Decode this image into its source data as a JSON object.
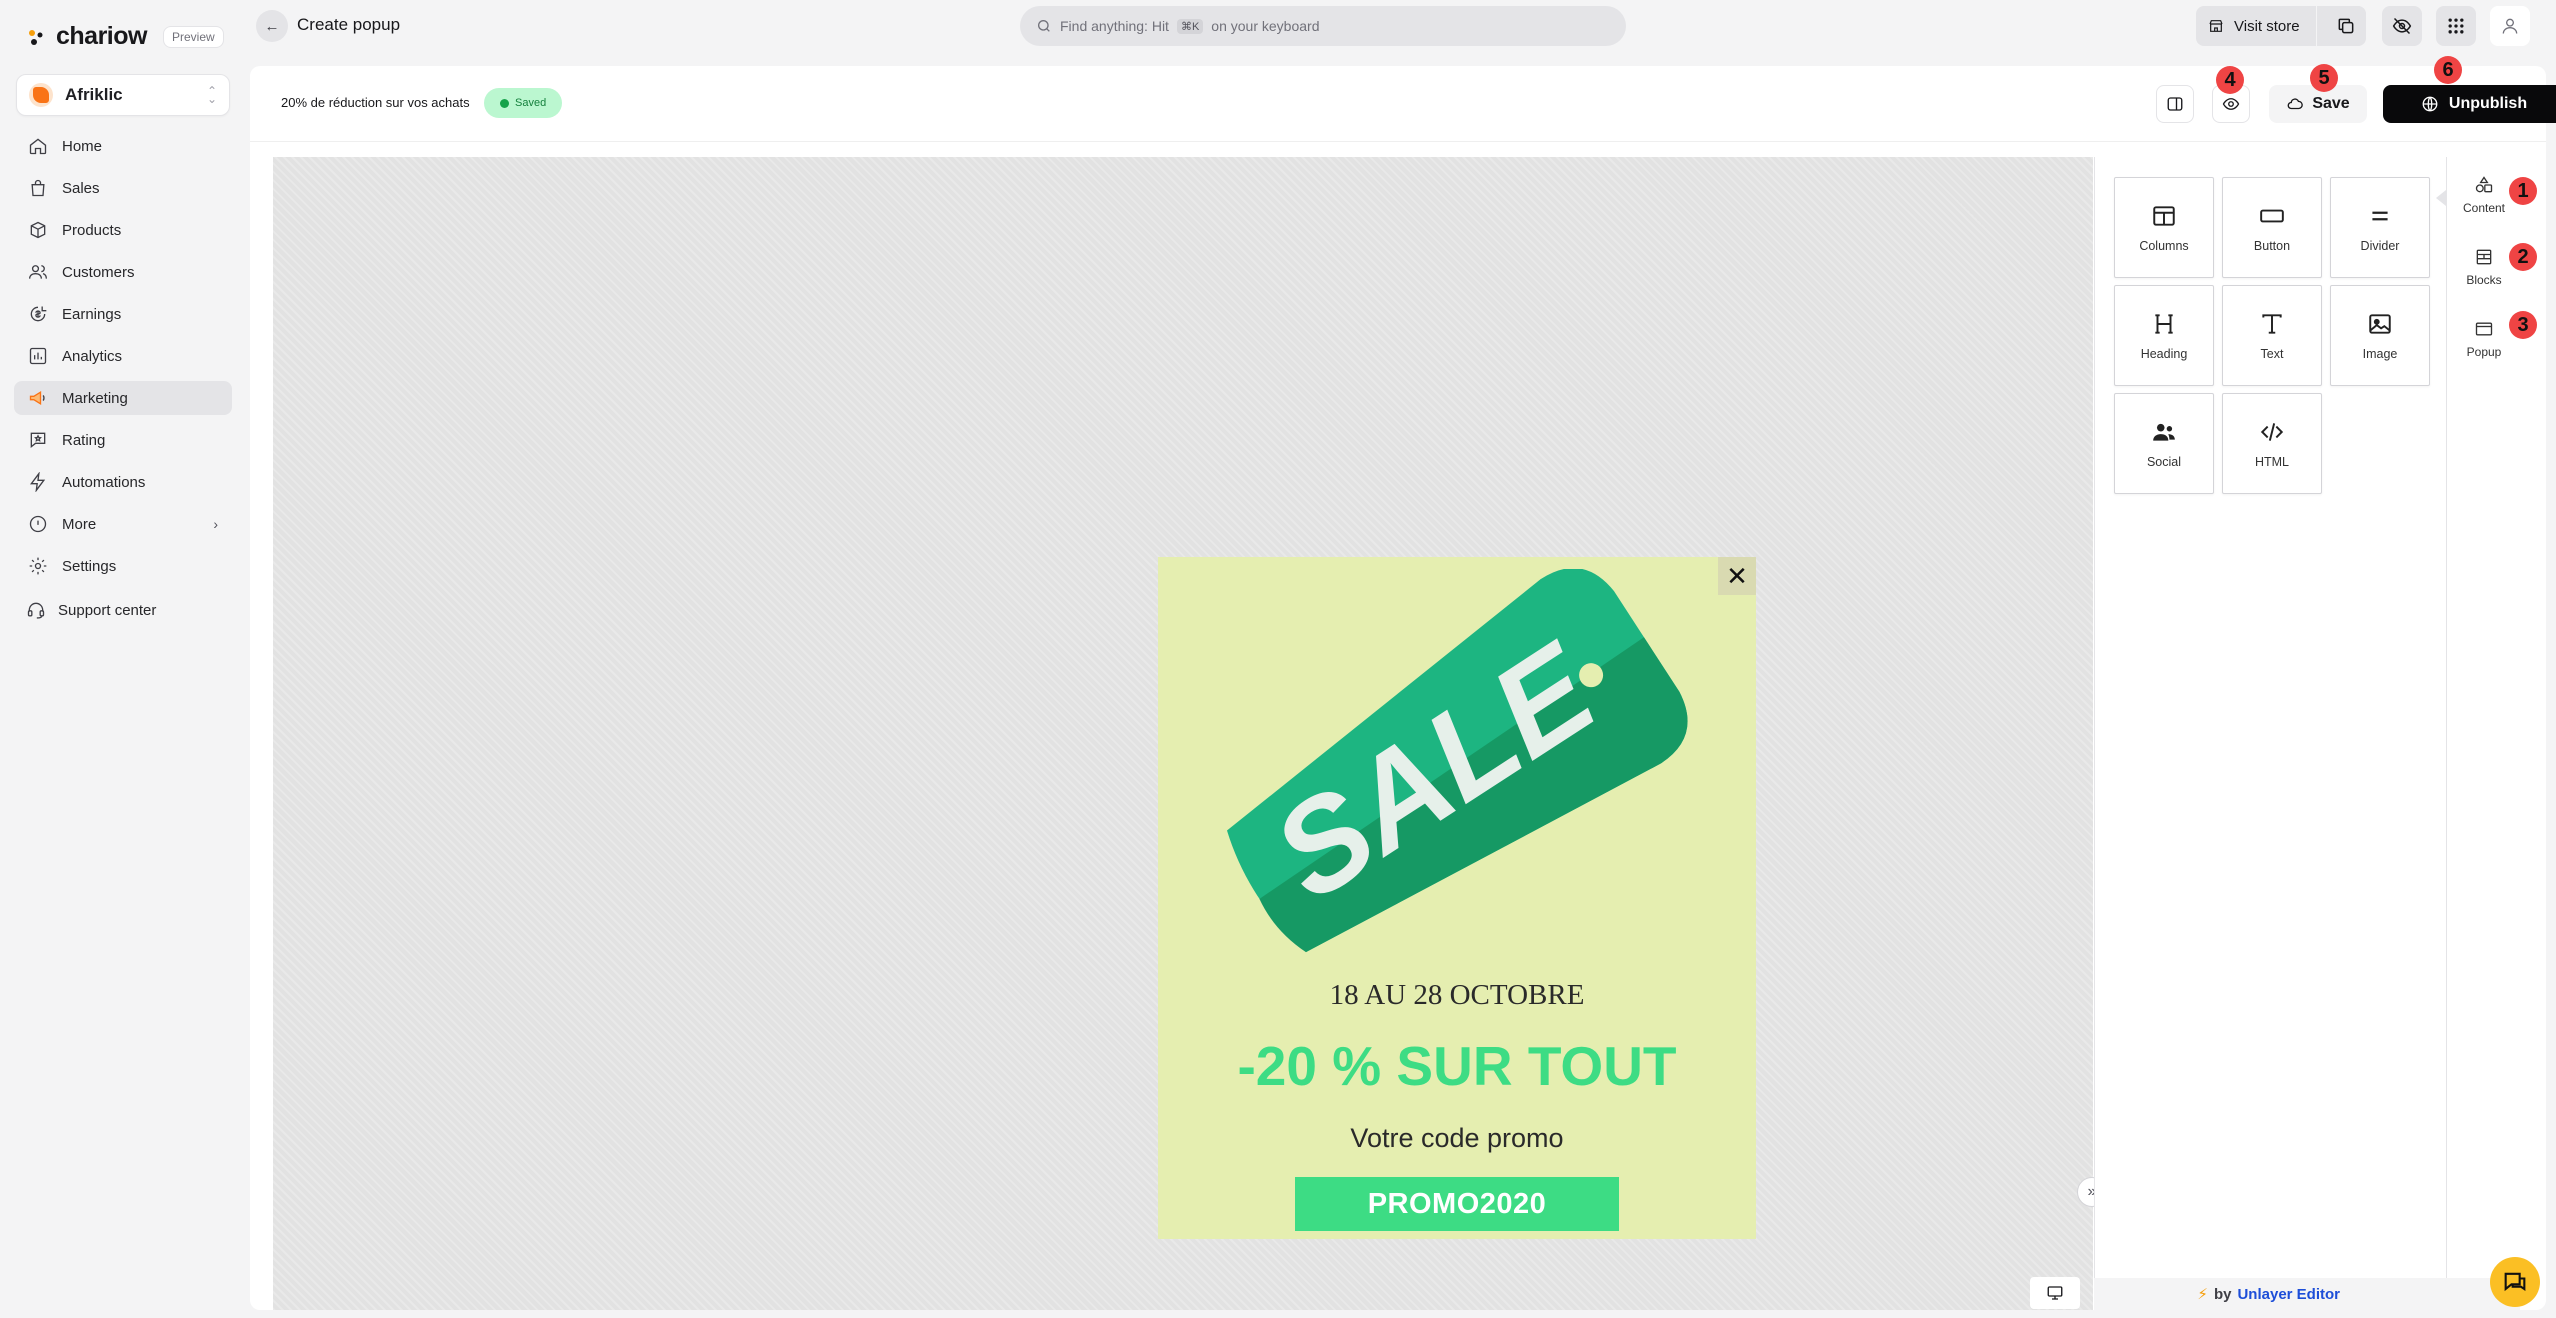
{
  "app": {
    "logo_text": "chariow",
    "badge": "Preview",
    "page_title": "Create popup"
  },
  "store": {
    "name": "Afriklic"
  },
  "sidebar": {
    "items": [
      {
        "label": "Home",
        "icon": "home-icon"
      },
      {
        "label": "Sales",
        "icon": "shopping-bag-icon"
      },
      {
        "label": "Products",
        "icon": "box-icon"
      },
      {
        "label": "Customers",
        "icon": "users-icon"
      },
      {
        "label": "Earnings",
        "icon": "earnings-icon"
      },
      {
        "label": "Analytics",
        "icon": "bar-chart-icon"
      },
      {
        "label": "Marketing",
        "icon": "megaphone-icon",
        "active": true
      },
      {
        "label": "Rating",
        "icon": "message-star-icon"
      },
      {
        "label": "Automations",
        "icon": "lightning-icon"
      },
      {
        "label": "More",
        "icon": "info-icon",
        "chevron": "›"
      },
      {
        "label": "Settings",
        "icon": "gear-icon"
      }
    ],
    "support_label": "Support center"
  },
  "topbar": {
    "search_prefix": "Find anything: Hit",
    "search_kbd": "⌘K",
    "search_suffix": "on your keyboard",
    "visit_store": "Visit store"
  },
  "editor": {
    "popup_name": "20% de réduction sur vos achats",
    "status": "Saved",
    "save_label": "Save",
    "unpublish_label": "Unpublish",
    "markers": [
      "1",
      "2",
      "3",
      "4",
      "5",
      "6"
    ]
  },
  "popup": {
    "close_glyph": "✕",
    "tag_text": "SALE",
    "date_text": "18 AU 28 OCTOBRE",
    "discount_text": "-20 % SUR TOUT",
    "code_label": "Votre code promo",
    "promo_code": "PROMO2020",
    "colors": {
      "background": "#e5eeb0",
      "accent": "#3ddc84",
      "tag": "#1db581"
    }
  },
  "tools": {
    "items": [
      {
        "label": "Columns",
        "icon": "columns-icon"
      },
      {
        "label": "Button",
        "icon": "button-icon"
      },
      {
        "label": "Divider",
        "icon": "divider-icon"
      },
      {
        "label": "Heading",
        "icon": "heading-icon"
      },
      {
        "label": "Text",
        "icon": "text-icon"
      },
      {
        "label": "Image",
        "icon": "image-icon"
      },
      {
        "label": "Social",
        "icon": "social-icon"
      },
      {
        "label": "HTML",
        "icon": "code-icon"
      }
    ],
    "tabs": [
      {
        "label": "Content",
        "icon": "shapes-icon"
      },
      {
        "label": "Blocks",
        "icon": "blocks-icon"
      },
      {
        "label": "Popup",
        "icon": "window-icon"
      }
    ]
  },
  "footer": {
    "by": "by",
    "brand": "Unlayer Editor"
  }
}
